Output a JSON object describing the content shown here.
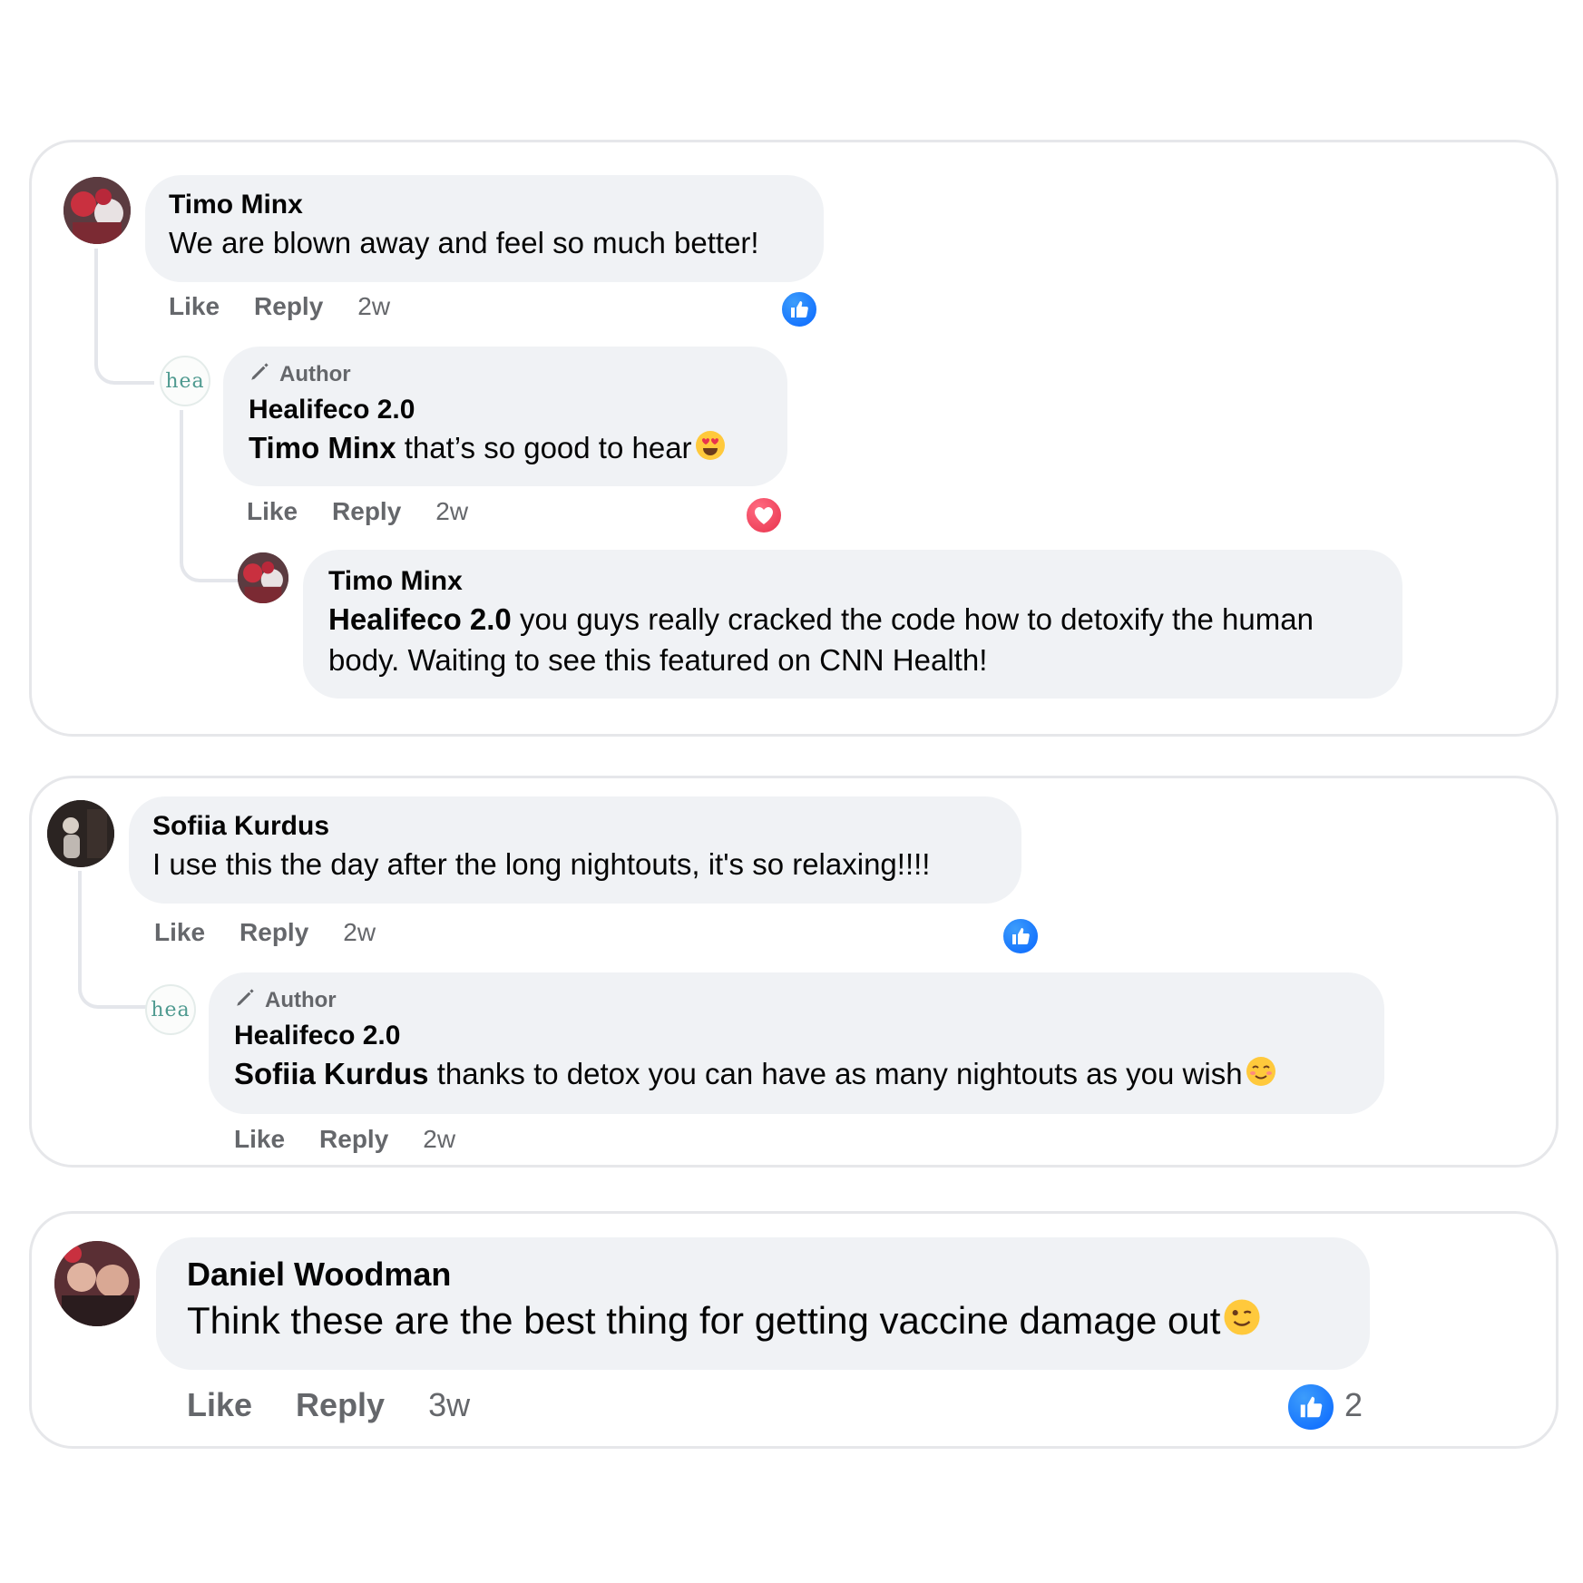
{
  "colors": {
    "bubble_bg": "#f0f2f5",
    "secondary_text": "#65676b",
    "like_blue": "#0866ff",
    "love_red": "#e8334d",
    "card_border": "#e6e7ea"
  },
  "threads": [
    {
      "comment": {
        "author": "Timo Minx",
        "text": "We are blown away and feel so much better!",
        "like_label": "Like",
        "reply_label": "Reply",
        "time": "2w",
        "reaction": "like-icon"
      },
      "reply": {
        "avatar_text": "hea",
        "badge": "Author",
        "author": "Healifeco 2.0",
        "mention": "Timo Minx",
        "text": " that’s so good to hear",
        "emoji": "heart-eyes-emoji",
        "like_label": "Like",
        "reply_label": "Reply",
        "time": "2w",
        "reaction": "love-icon"
      },
      "nested_reply": {
        "author": "Timo Minx",
        "mention": "Healifeco 2.0",
        "text": " you guys really cracked the code how to detoxify the human body. Waiting to see this featured on CNN Health!"
      }
    },
    {
      "comment": {
        "author": "Sofiia Kurdus",
        "text": "I use this the day after the long nightouts, it's so relaxing!!!!",
        "like_label": "Like",
        "reply_label": "Reply",
        "time": "2w",
        "reaction": "like-icon"
      },
      "reply": {
        "avatar_text": "hea",
        "badge": "Author",
        "author": "Healifeco 2.0",
        "mention": "Sofiia Kurdus",
        "text": " thanks to detox you can have as many nightouts as you wish",
        "emoji": "smiling-blush-emoji",
        "like_label": "Like",
        "reply_label": "Reply",
        "time": "2w"
      }
    },
    {
      "comment": {
        "author": "Daniel Woodman",
        "text": "Think these are the best thing for getting vaccine damage out",
        "emoji": "wink-emoji",
        "like_label": "Like",
        "reply_label": "Reply",
        "time": "3w",
        "reaction": "like-icon",
        "reaction_count": "2"
      }
    }
  ]
}
